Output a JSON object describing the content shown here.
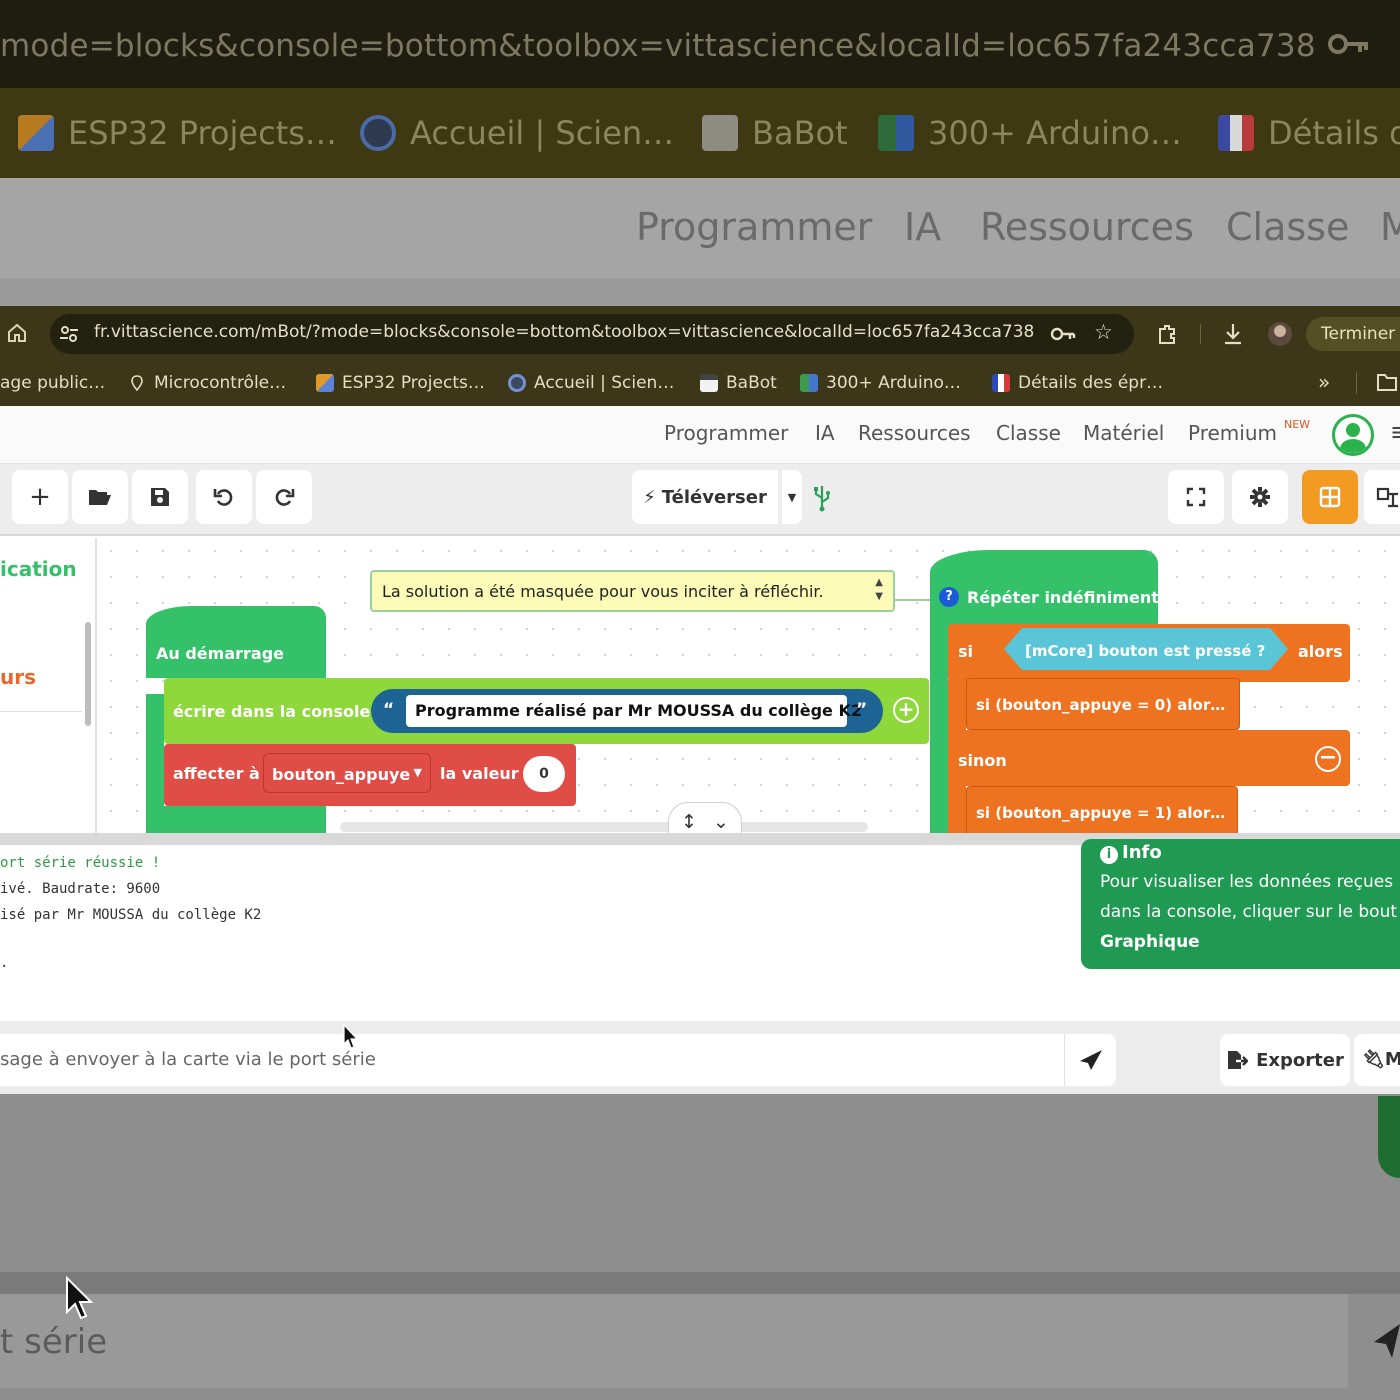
{
  "background_window": {
    "url_text": "mode=blocks&console=bottom&toolbox=vittascience&localId=loc657fa243cca738",
    "bookmarks": [
      {
        "label": "ESP32 Projects…",
        "icon": "esp-icon"
      },
      {
        "label": "Accueil | Scien…",
        "icon": "vittascience-icon"
      },
      {
        "label": "BaBot",
        "icon": "babot-icon"
      },
      {
        "label": "300+ Arduino…",
        "icon": "arduino-icon"
      },
      {
        "label": "Détails d",
        "icon": "marianne-icon"
      }
    ],
    "nav": [
      "Programmer",
      "IA",
      "Ressources",
      "Classe",
      "M"
    ],
    "console_input_text": "t série"
  },
  "browser": {
    "url": "fr.vittascience.com/mBot/?mode=blocks&console=bottom&toolbox=vittascience&localId=loc657fa243cca738",
    "finish_label": "Terminer",
    "bookmarks": [
      {
        "label": "age public…",
        "icon": "page-icon"
      },
      {
        "label": "Microcontrôle…",
        "icon": "pin-icon"
      },
      {
        "label": "ESP32 Projects…",
        "icon": "esp-icon"
      },
      {
        "label": "Accueil | Scien…",
        "icon": "vittascience-icon"
      },
      {
        "label": "BaBot",
        "icon": "babot-icon"
      },
      {
        "label": "300+ Arduino…",
        "icon": "arduino-icon"
      },
      {
        "label": "Détails des épr…",
        "icon": "marianne-icon"
      }
    ],
    "bookmarks_more": "»"
  },
  "site_nav": {
    "items": [
      "Programmer",
      "IA",
      "Ressources",
      "Classe",
      "Matériel",
      "Premium"
    ],
    "new_badge": "NEW"
  },
  "toolbar": {
    "upload_label": "Téléverser"
  },
  "sidebar": {
    "categories": [
      {
        "label": "ication",
        "color": "#35c16a"
      },
      {
        "label": "urs",
        "color": "#e8682c"
      }
    ]
  },
  "workspace": {
    "comment": "La solution a été masquée pour vous inciter à réfléchir.",
    "setup_block": {
      "hat_label": "Au démarrage",
      "print_label": "écrire dans la console",
      "print_text": "Programme réalisé par Mr MOUSSA du collège K2",
      "quote_open": "“",
      "quote_close": "”",
      "set_label": "affecter à",
      "set_variable": "bouton_appuye",
      "set_value_label": "la valeur",
      "set_value": "0"
    },
    "loop_block": {
      "hat_label": "Répéter indéfiniment",
      "if_label": "si",
      "condition": "[mCore] bouton est pressé ?",
      "then_label": "alors",
      "inner_if_1": "si (bouton_appuye = 0) alor…",
      "else_label": "sinon",
      "inner_if_2": "si (bouton_appuye = 1) alor…"
    }
  },
  "console": {
    "lines": [
      {
        "text": "ort série réussie !",
        "ok": true
      },
      {
        "text": "ivé. Baudrate: 9600",
        "ok": false
      },
      {
        "text": "isé par Mr MOUSSA du collège K2",
        "ok": false
      },
      {
        "text": "",
        "ok": false
      },
      {
        "text": ".",
        "ok": false
      }
    ],
    "info": {
      "title": "Info",
      "lines": [
        "Pour visualiser les données reçues",
        "dans la console, cliquer sur le bout"
      ],
      "bold_word": "Graphique"
    },
    "input_placeholder": "sage à envoyer à la carte via le port série",
    "export_label": "Exporter",
    "plug_label": "M"
  },
  "colors": {
    "brand_green": "#35c16a",
    "block_orange": "#ee7321",
    "block_red": "#df4d46",
    "block_lime": "#8ed83b",
    "string_blue": "#1d6495",
    "info_green": "#209a52",
    "accent_orange": "#f39a23"
  }
}
